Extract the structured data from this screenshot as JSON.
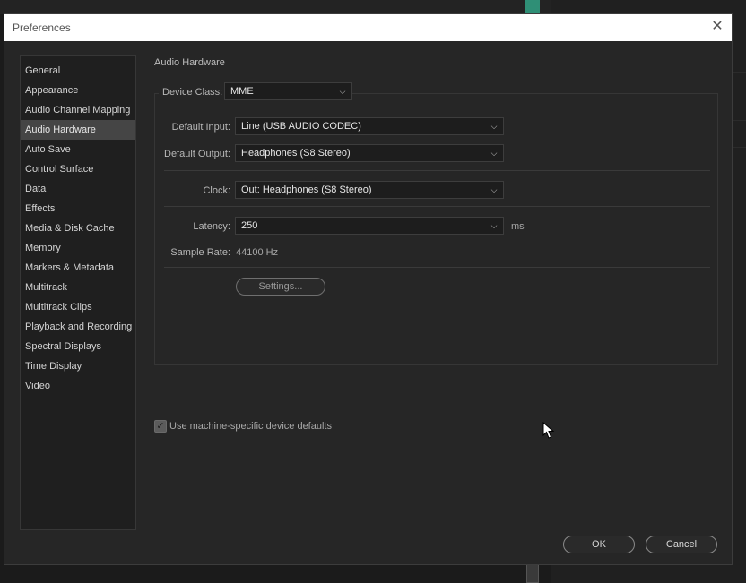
{
  "dialog": {
    "title": "Preferences",
    "close_glyph": "✕"
  },
  "sidebar": {
    "items": [
      {
        "label": "General"
      },
      {
        "label": "Appearance"
      },
      {
        "label": "Audio Channel Mapping"
      },
      {
        "label": "Audio Hardware",
        "selected": true
      },
      {
        "label": "Auto Save"
      },
      {
        "label": "Control Surface"
      },
      {
        "label": "Data"
      },
      {
        "label": "Effects"
      },
      {
        "label": "Media & Disk Cache"
      },
      {
        "label": "Memory"
      },
      {
        "label": "Markers & Metadata"
      },
      {
        "label": "Multitrack"
      },
      {
        "label": "Multitrack Clips"
      },
      {
        "label": "Playback and Recording"
      },
      {
        "label": "Spectral Displays"
      },
      {
        "label": "Time Display"
      },
      {
        "label": "Video"
      }
    ]
  },
  "audio_hardware": {
    "section_title": "Audio Hardware",
    "device_class": {
      "label": "Device Class:",
      "value": "MME"
    },
    "default_input": {
      "label": "Default Input:",
      "value": "Line (USB AUDIO  CODEC)"
    },
    "default_output": {
      "label": "Default Output:",
      "value": "Headphones (S8 Stereo)"
    },
    "clock": {
      "label": "Clock:",
      "value": "Out: Headphones (S8 Stereo)"
    },
    "latency": {
      "label": "Latency:",
      "value": "250",
      "unit": "ms"
    },
    "sample_rate": {
      "label": "Sample Rate:",
      "value": "44100 Hz"
    },
    "settings_button": "Settings...",
    "machine_defaults": {
      "label": "Use machine-specific device defaults",
      "checked": true
    }
  },
  "footer": {
    "ok_label": "OK",
    "cancel_label": "Cancel"
  },
  "colors": {
    "selected_bg": "#454545",
    "panel_bg": "#262626",
    "titlebar_bg": "#ffffff"
  },
  "icons": {
    "dropdown": "chevron-down-icon",
    "close": "close-icon",
    "check": "checkmark-icon",
    "cursor": "mouse-pointer-icon"
  }
}
